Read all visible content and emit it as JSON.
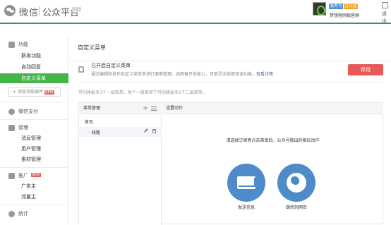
{
  "header": {
    "brand": "微信",
    "product": "公众平台",
    "account_tags": [
      "服务号",
      "已认证"
    ],
    "account_name": "梦想程网络营销",
    "exit_label": "退出"
  },
  "sidebar": {
    "sections": [
      {
        "title": "功能",
        "icon": "grid-icon"
      },
      {
        "title": "微信支付",
        "icon": "pay-icon"
      },
      {
        "title": "管理",
        "icon": "folder-icon"
      },
      {
        "title": "推广",
        "icon": "megaphone-icon",
        "badge": "NEW"
      },
      {
        "title": "统计",
        "icon": "chart-icon"
      }
    ],
    "function_items": [
      "群发功能",
      "自动回复",
      "自定义菜单"
    ],
    "add_plugin_label": "添加功能插件",
    "add_plugin_badge": "NEW",
    "manage_items": [
      "消息管理",
      "用户管理",
      "素材管理"
    ],
    "promo_items": [
      "广告主",
      "流量主"
    ]
  },
  "main": {
    "title": "自定义菜单",
    "notice_title": "已开启自定义菜单",
    "notice_desc": "通过编辑和发布自定义菜单来进行便携管理，如具备开发能力，可更灵活地使用该功能。",
    "notice_link": "查看详情",
    "stop_button": "停用",
    "hint": "可创建最多3个一级菜单，每个一级菜单下可创建最多5个二级菜单。",
    "menu_mgmt_title": "菜单管理",
    "menu_items": [
      "首页",
      "线路"
    ],
    "action_title": "设置动作",
    "action_prompt": "请选择订阅者点击菜单后，公众号做出的相应动作",
    "actions": [
      "发送信息",
      "跳转到网页"
    ]
  },
  "colors": {
    "accent": "#44b549",
    "danger": "#e85a5a",
    "action_blue": "#4f8ac9"
  }
}
